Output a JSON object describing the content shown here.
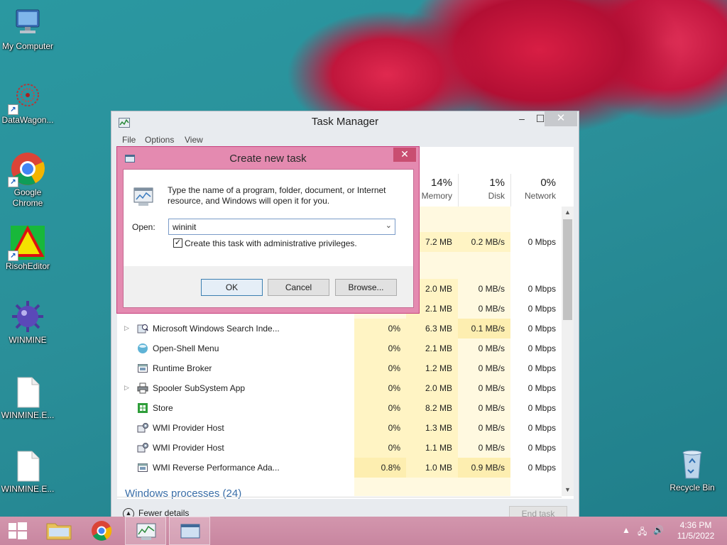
{
  "desktop": {
    "icons": [
      {
        "label": "My Computer"
      },
      {
        "label": "DataWagon..."
      },
      {
        "label": "Google Chrome"
      },
      {
        "label": "RisohEditor"
      },
      {
        "label": "WINMINE"
      },
      {
        "label": "WINMINE.E..."
      },
      {
        "label": "WINMINE.E..."
      },
      {
        "label": "Recycle Bin"
      }
    ]
  },
  "taskmanager": {
    "title": "Task Manager",
    "menu": [
      "File",
      "Options",
      "View"
    ],
    "columns": [
      {
        "pct": "14%",
        "name": "Memory"
      },
      {
        "pct": "1%",
        "name": "Disk"
      },
      {
        "pct": "0%",
        "name": "Network"
      }
    ],
    "partial_rows": [
      {
        "mem": "7.2 MB",
        "disk": "0.2 MB/s",
        "net": "0 Mbps"
      },
      {
        "mem": "2.0 MB",
        "disk": "0 MB/s",
        "net": "0 Mbps"
      },
      {
        "mem": "2.1 MB",
        "disk": "0 MB/s",
        "net": "0 Mbps"
      }
    ],
    "rows": [
      {
        "name": "Microsoft Windows Search Inde...",
        "cpu": "0%",
        "mem": "6.3 MB",
        "disk": "0.1 MB/s",
        "net": "0 Mbps",
        "icon": "search-indexer-icon"
      },
      {
        "name": "Open-Shell Menu",
        "cpu": "0%",
        "mem": "2.1 MB",
        "disk": "0 MB/s",
        "net": "0 Mbps",
        "icon": "open-shell-icon"
      },
      {
        "name": "Runtime Broker",
        "cpu": "0%",
        "mem": "1.2 MB",
        "disk": "0 MB/s",
        "net": "0 Mbps",
        "icon": "window-app-icon"
      },
      {
        "name": "Spooler SubSystem App",
        "cpu": "0%",
        "mem": "2.0 MB",
        "disk": "0 MB/s",
        "net": "0 Mbps",
        "icon": "printer-icon"
      },
      {
        "name": "Store",
        "cpu": "0%",
        "mem": "8.2 MB",
        "disk": "0 MB/s",
        "net": "0 Mbps",
        "icon": "store-icon"
      },
      {
        "name": "WMI Provider Host",
        "cpu": "0%",
        "mem": "1.3 MB",
        "disk": "0 MB/s",
        "net": "0 Mbps",
        "icon": "wmi-icon"
      },
      {
        "name": "WMI Provider Host",
        "cpu": "0%",
        "mem": "1.1 MB",
        "disk": "0 MB/s",
        "net": "0 Mbps",
        "icon": "wmi-icon"
      },
      {
        "name": "WMI Reverse Performance Ada...",
        "cpu": "0.8%",
        "mem": "1.0 MB",
        "disk": "0.9 MB/s",
        "net": "0 Mbps",
        "icon": "window-app-icon"
      }
    ],
    "group_label": "Windows processes (24)",
    "fewer_details": "Fewer details",
    "end_task": "End task"
  },
  "dialog": {
    "title": "Create new task",
    "message": "Type the name of a program, folder, document, or Internet resource, and Windows will open it for you.",
    "open_label": "Open:",
    "open_value": "wininit",
    "checkbox_label": "Create this task with administrative privileges.",
    "checkbox_checked": true,
    "ok": "OK",
    "cancel": "Cancel",
    "browse": "Browse..."
  },
  "taskbar": {
    "time": "4:36 PM",
    "date": "11/5/2022"
  },
  "colors": {
    "dialog_frame": "#e48ab0",
    "taskbar": "#cc8aa4",
    "group_label": "#3a6ea8"
  }
}
